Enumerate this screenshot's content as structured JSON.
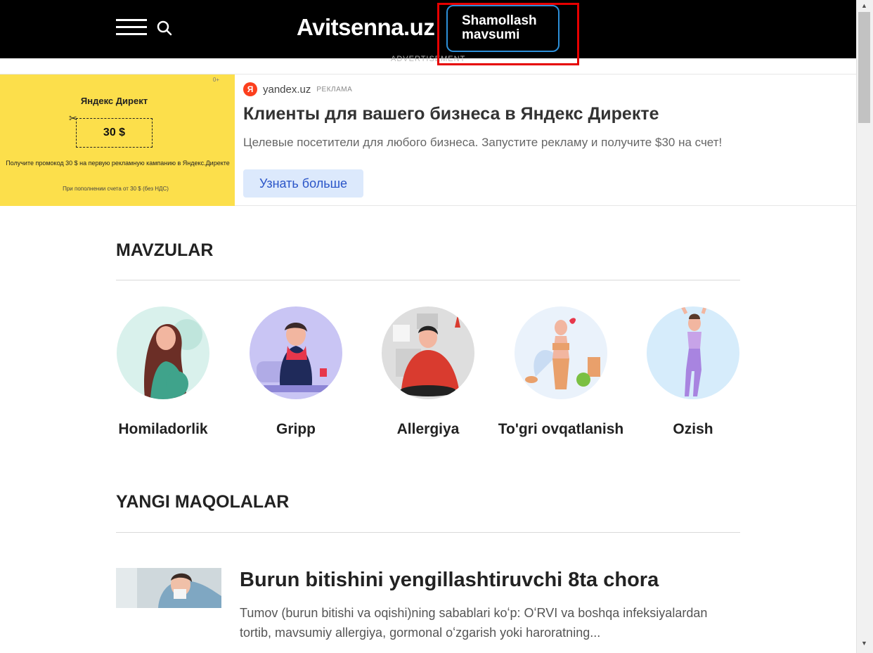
{
  "header": {
    "logo": "Avitsenna.uz",
    "season_button": {
      "line1": "Shamollash",
      "line2": "mavsumi"
    },
    "advertisement_label": "ADVERTISEMENT"
  },
  "ad": {
    "image": {
      "brand": "Яндекс Директ",
      "age": "0+",
      "coupon": "30 $",
      "promo": "Получите промокод 30 $ на первую рекламную кампанию в Яндекс.Директе",
      "note": "При пополнении  счета от 30 $ (без НДС)"
    },
    "source_icon": "Я",
    "domain": "yandex.uz",
    "tag": "РЕКЛАМА",
    "title": "Клиенты для вашего бизнеса в Яндекс Директе",
    "description": "Целевые посетители для любого бизнеса. Запустите рекламу и получите $30 на счет!",
    "button": "Узнать больше"
  },
  "topics": {
    "title": "MAVZULAR",
    "items": [
      {
        "label": "Homiladorlik",
        "bg": "#d9f1ec"
      },
      {
        "label": "Gripp",
        "bg": "#c9c5f4"
      },
      {
        "label": "Allergiya",
        "bg": "#dedede"
      },
      {
        "label": "To'gri ovqatlanish",
        "bg": "#eaf2fb"
      },
      {
        "label": "Ozish",
        "bg": "#d6ecfb"
      }
    ]
  },
  "articles": {
    "title": "YANGI MAQOLALAR",
    "items": [
      {
        "title": "Burun bitishini yengillashtiruvchi 8ta chora",
        "description": "Tumov (burun bitishi va oqishi)ning sabablari koʻp: OʻRVI va boshqa infeksiyalardan tortib, mavsumiy allergiya, gormonal oʻzgarish yoki haroratning..."
      }
    ]
  }
}
